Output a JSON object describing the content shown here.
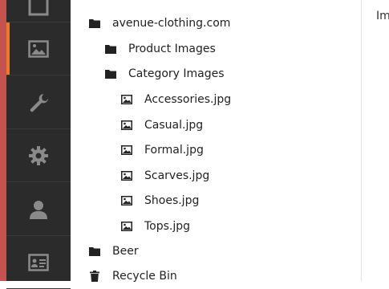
{
  "sidebar": {
    "items": [
      {
        "name": "media",
        "icon": "image-icon",
        "active": true
      },
      {
        "name": "tools",
        "icon": "wrench-icon"
      },
      {
        "name": "settings",
        "icon": "gear-icon"
      },
      {
        "name": "users",
        "icon": "user-icon"
      },
      {
        "name": "contacts",
        "icon": "id-card-icon"
      }
    ],
    "accent_color": "#e8792d",
    "edge_color": "#c4524f"
  },
  "tree": {
    "root": {
      "label": "avenue-clothing.com",
      "icon": "folder-icon"
    },
    "product_images": {
      "label": "Product Images",
      "icon": "folder-icon"
    },
    "category_images": {
      "label": "Category Images",
      "icon": "folder-icon"
    },
    "files": [
      {
        "label": "Accessories.jpg",
        "icon": "image-file-icon"
      },
      {
        "label": "Casual.jpg",
        "icon": "image-file-icon"
      },
      {
        "label": "Formal.jpg",
        "icon": "image-file-icon"
      },
      {
        "label": "Scarves.jpg",
        "icon": "image-file-icon"
      },
      {
        "label": "Shoes.jpg",
        "icon": "image-file-icon"
      },
      {
        "label": "Tops.jpg",
        "icon": "image-file-icon"
      }
    ],
    "beer": {
      "label": "Beer",
      "icon": "folder-icon"
    },
    "recycle_bin": {
      "label": "Recycle Bin",
      "icon": "trash-icon"
    }
  },
  "right_panel": {
    "label": "Im"
  }
}
